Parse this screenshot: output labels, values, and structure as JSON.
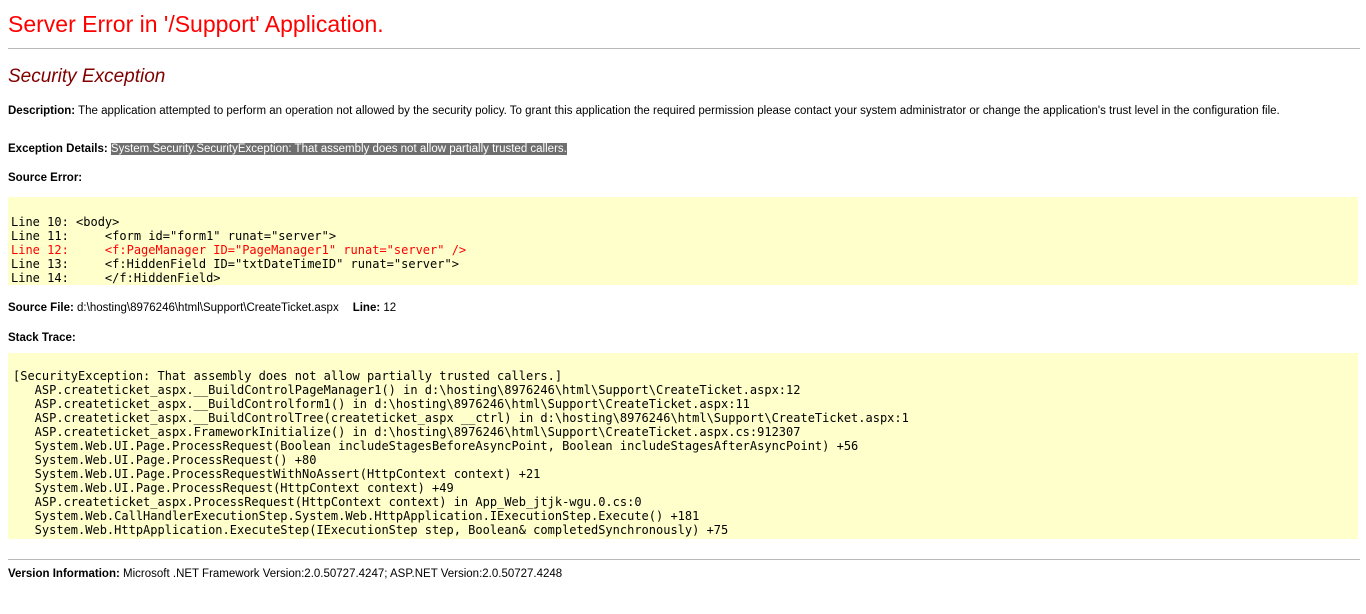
{
  "header": {
    "title": "Server Error in '/Support' Application."
  },
  "exception": {
    "title": "Security Exception",
    "description_label": "Description:",
    "description_text": "The application attempted to perform an operation not allowed by the security policy.  To grant this application the required permission please contact your system administrator or change the application's trust level in the configuration file.",
    "details_label": "Exception Details:",
    "details_text": "System.Security.SecurityException: That assembly does not allow partially trusted callers."
  },
  "source_error": {
    "label": "Source Error:",
    "lines": [
      {
        "text": "Line 10: <body>",
        "error": false
      },
      {
        "text": "Line 11:     <form id=\"form1\" runat=\"server\">",
        "error": false
      },
      {
        "text": "Line 12:     <f:PageManager ID=\"PageManager1\" runat=\"server\" />",
        "error": true
      },
      {
        "text": "Line 13:     <f:HiddenField ID=\"txtDateTimeID\" runat=\"server\">",
        "error": false
      },
      {
        "text": "Line 14:     </f:HiddenField>",
        "error": false
      }
    ]
  },
  "source_file": {
    "label": "Source File:",
    "path": "d:\\hosting\\8976246\\html\\Support\\CreateTicket.aspx",
    "line_label": "Line:",
    "line_number": "12"
  },
  "stack_trace": {
    "label": "Stack Trace:",
    "lines": [
      "[SecurityException: That assembly does not allow partially trusted callers.]",
      "   ASP.createticket_aspx.__BuildControlPageManager1() in d:\\hosting\\8976246\\html\\Support\\CreateTicket.aspx:12",
      "   ASP.createticket_aspx.__BuildControlform1() in d:\\hosting\\8976246\\html\\Support\\CreateTicket.aspx:11",
      "   ASP.createticket_aspx.__BuildControlTree(createticket_aspx __ctrl) in d:\\hosting\\8976246\\html\\Support\\CreateTicket.aspx:1",
      "   ASP.createticket_aspx.FrameworkInitialize() in d:\\hosting\\8976246\\html\\Support\\CreateTicket.aspx.cs:912307",
      "   System.Web.UI.Page.ProcessRequest(Boolean includeStagesBeforeAsyncPoint, Boolean includeStagesAfterAsyncPoint) +56",
      "   System.Web.UI.Page.ProcessRequest() +80",
      "   System.Web.UI.Page.ProcessRequestWithNoAssert(HttpContext context) +21",
      "   System.Web.UI.Page.ProcessRequest(HttpContext context) +49",
      "   ASP.createticket_aspx.ProcessRequest(HttpContext context) in App_Web_jtjk-wgu.0.cs:0",
      "   System.Web.CallHandlerExecutionStep.System.Web.HttpApplication.IExecutionStep.Execute() +181",
      "   System.Web.HttpApplication.ExecuteStep(IExecutionStep step, Boolean& completedSynchronously) +75"
    ]
  },
  "version": {
    "label": "Version Information:",
    "text": "Microsoft .NET Framework Version:2.0.50727.4247; ASP.NET Version:2.0.50727.4248"
  },
  "colors": {
    "title": "#ff0000",
    "subtitle": "#800000",
    "code_background": "#ffffcc",
    "error_line": "#ff0000",
    "highlight_background": "#6f6f6f"
  }
}
